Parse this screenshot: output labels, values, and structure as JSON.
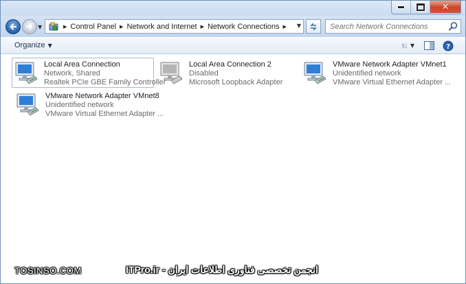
{
  "window": {
    "caption_minimize": "minimize",
    "caption_maximize": "maximize",
    "caption_close": "✕"
  },
  "address": {
    "crumbs": [
      "Control Panel",
      "Network and Internet",
      "Network Connections"
    ]
  },
  "search": {
    "placeholder": "Search Network Connections"
  },
  "commandbar": {
    "organize_label": "Organize"
  },
  "connections": [
    {
      "name": "Local Area Connection",
      "status": "Network, Shared",
      "device": "Realtek PCIe GBE Family Controller",
      "selected": true
    },
    {
      "name": "Local Area Connection 2",
      "status": "Disabled",
      "device": "Microsoft Loopback Adapter",
      "selected": false
    },
    {
      "name": "VMware Network Adapter VMnet1",
      "status": "Unidentified network",
      "device": "VMware Virtual Ethernet Adapter ...",
      "selected": false
    },
    {
      "name": "VMware Network Adapter VMnet8",
      "status": "Unidentified network",
      "device": "VMware Virtual Ethernet Adapter ...",
      "selected": false
    }
  ],
  "watermark": {
    "left": "TOSINSO.COM",
    "center": "انجمن تخصصی فناوری اطلاعات ایران - ITPro.ir"
  },
  "icons": {
    "back": "back-arrow-icon",
    "forward": "forward-arrow-icon",
    "address": "network-folder-icon",
    "refresh": "refresh-icon",
    "search": "search-icon",
    "view": "change-view-icon",
    "preview": "preview-pane-icon",
    "help": "help-icon",
    "connection": "network-adapter-icon"
  },
  "colors": {
    "accent": "#1f5ea8",
    "close": "#c9462a",
    "selection_border": "#a9b7c9"
  }
}
